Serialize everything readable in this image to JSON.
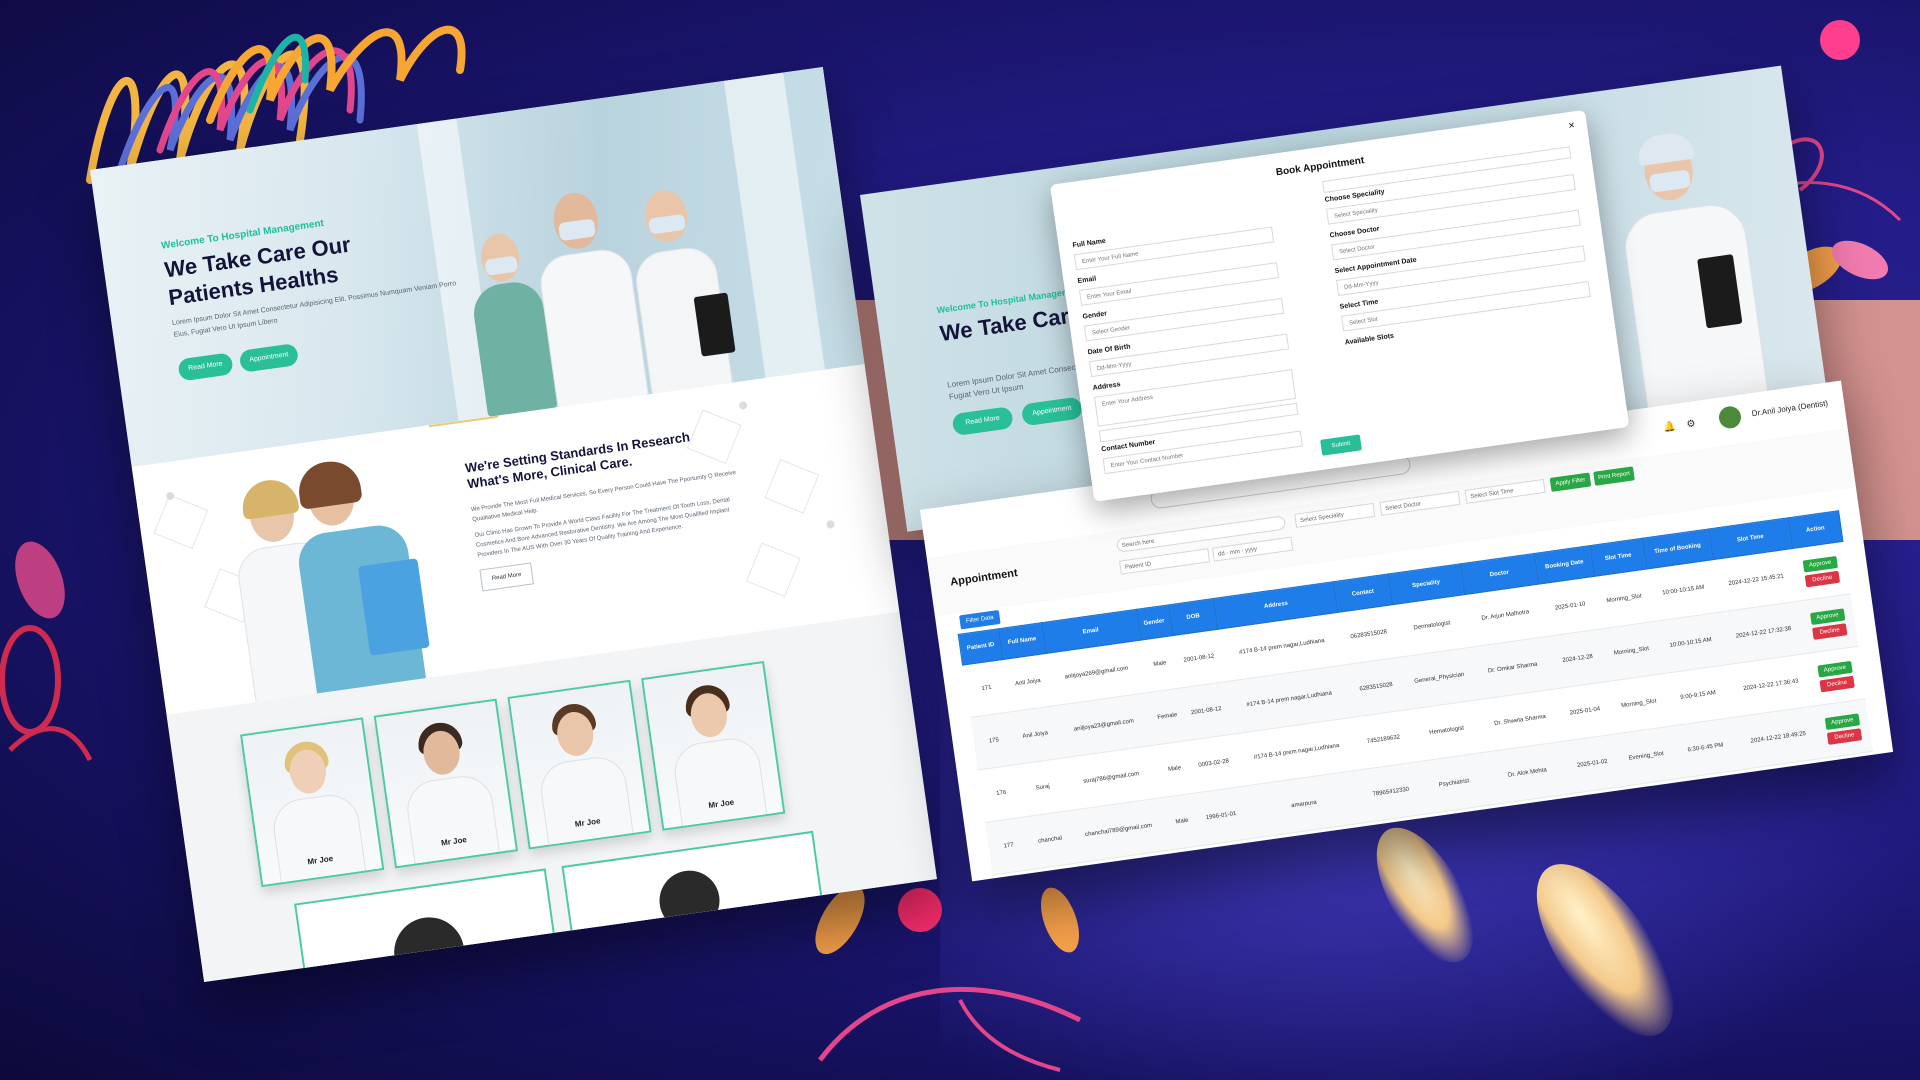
{
  "left_page": {
    "hero": {
      "eyebrow": "Welcome To Hospital Management",
      "title": "We Take Care Our Patients Healths",
      "lead": "Lorem Ipsum Dolor Sit Amet Consectetur Adipisicing Elit. Possimus Numquam Veniam Porro Eius, Fugiat Vero Ut Ipsum Libero",
      "read_more": "Read More",
      "appointment": "Appointment"
    },
    "research": {
      "title": "We're Setting Standards In Research What's More, Clinical Care.",
      "p1": "We Provide The Most Full Medical Services, So Every Person Could Have The Pportunity O Receive Qualitative Medical Help.",
      "p2": "Our Clinic Has Grown To Provide A World Class Facility For The Treatment Of Tooth Loss, Dental Cosmetics And Bore Advanced Restorative Dentistry. We Are Among The Most Qualified Implant Providers In The AUS With Over 30 Years Of Quality Training And Experience.",
      "read_more": "Read More"
    },
    "doctors": [
      "Mr Joe",
      "Mr Joe",
      "Mr Joe",
      "Mr Joe"
    ]
  },
  "right_hero": {
    "eyebrow": "Welcome To Hospital Management",
    "title": "We Take Care Our Patients Healths",
    "lead": "Lorem Ipsum Dolor Sit Amet Consectetur Porro Eius, Fugiat Vero Ut Ipsum",
    "read_more": "Read More",
    "appointment": "Appointment"
  },
  "modal": {
    "title": "Book Appointment",
    "close": "×",
    "full_name_label": "Full Name",
    "full_name_placeholder": "Enter Your Full Name",
    "email_label": "Email",
    "email_placeholder": "Enter Your Email",
    "gender_label": "Gender",
    "gender_value": "Select Gender",
    "dob_label": "Date Of Birth",
    "dob_value": "Dd-Mm-Yyyy",
    "address_label": "Address",
    "address_placeholder": "Enter Your Address",
    "contact_label": "Contact Number",
    "contact_placeholder": "Enter Your Contact Number",
    "speciality_label": "Choose Speciality",
    "speciality_value": "Select Speciality",
    "doctor_label": "Choose Doctor",
    "doctor_value": "Select Doctor",
    "date_label": "Select Appointment Date",
    "date_value": "Dd-Mm-Yyyy",
    "time_label": "Select Time",
    "time_value": "Select Slot",
    "slots_label": "Available Slots",
    "submit": "Submit"
  },
  "dashboard": {
    "user_name": "Dr.Anil Joiya (Dentist)",
    "search_placeholder": "Search here",
    "page_title": "Appointment",
    "filters": {
      "patient_id": "Patient ID",
      "date": "dd - mm - yyyy",
      "speciality": "Select Speciality",
      "doctor": "Select Doctor",
      "slot_time": "Select Slot Time",
      "apply": "Apply Filter",
      "print": "Print Report",
      "filter_data": "Filter Data"
    },
    "columns": [
      "Patient ID",
      "Full Name",
      "Email",
      "Gender",
      "DOB",
      "Address",
      "Contact",
      "Speciality",
      "Doctor",
      "Booking Date",
      "Slot Time",
      "Time of Booking",
      "Slot Time",
      "Action"
    ],
    "rows": [
      [
        "171",
        "Anil Joiya",
        "anitjoya269@gmail.com",
        "Male",
        "2001-08-12",
        "#174 B-14 prem nagar,Ludhiana",
        "06283515028",
        "Dermatologist",
        "Dr. Arjun Malhotra",
        "2025-01-10",
        "Morning_Slot",
        "10:00-10:15 AM",
        "2024-12-22 15:45:21"
      ],
      [
        "175",
        "Anil Joiya",
        "aniljoya23@gmail.com",
        "Female",
        "2001-08-12",
        "#174 B-14 prem nagar,Ludhiana",
        "6283515028",
        "General_Physician",
        "Dr. Omkar Sharma",
        "2024-12-28",
        "Morning_Slot",
        "10:00-10:15 AM",
        "2024-12-22 17:32:38"
      ],
      [
        "176",
        "Suraj",
        "suraj786@gmail.com",
        "Male",
        "0003-02-28",
        "#174 B-14 prem nagar,Ludhiana",
        "7452189632",
        "Hematologist",
        "Dr. Shweta Sharma",
        "2025-01-04",
        "Morning_Slot",
        "9:00-9:15 AM",
        "2024-12-22 17:36:43"
      ],
      [
        "177",
        "chanchal",
        "chanchal789@gmail.com",
        "Male",
        "1996-01-01",
        "amarpura",
        "78965412330",
        "Psychiatrist",
        "Dr. Alok Mehta",
        "2025-01-02",
        "Evening_Slot",
        "6:30-6:45 PM",
        "2024-12-22 18:49:25"
      ]
    ],
    "approve": "Approve",
    "decline": "Decline"
  },
  "colors": {
    "accent_green": "#29bf98",
    "table_blue": "#1e7de8",
    "approve_green": "#28a745",
    "decline_red": "#dc3545",
    "background_navy": "#231c86"
  }
}
